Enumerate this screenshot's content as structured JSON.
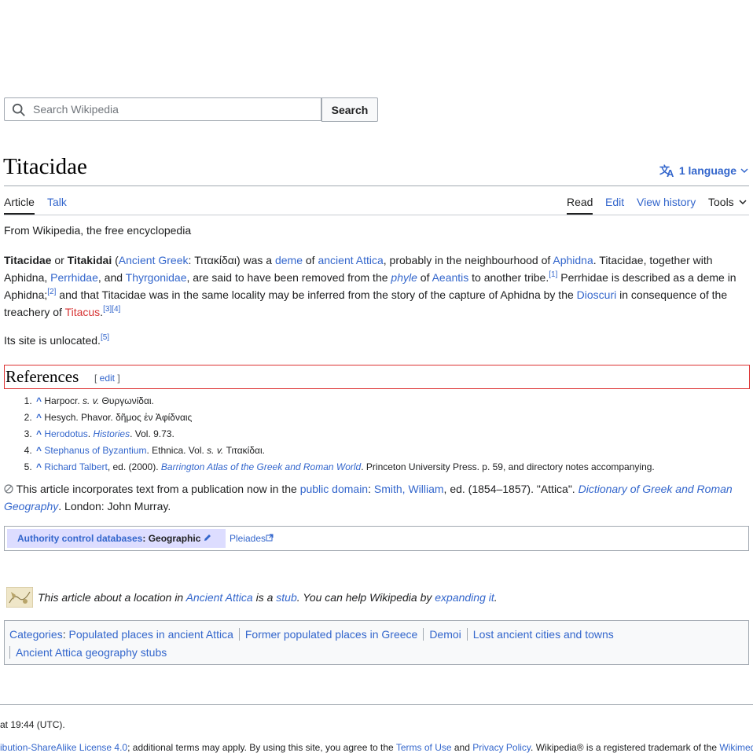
{
  "search": {
    "placeholder": "Search Wikipedia",
    "button_label": "Search"
  },
  "title": "Titacidae",
  "language": {
    "label": "1 language"
  },
  "tabs": {
    "article": "Article",
    "talk": "Talk",
    "read": "Read",
    "edit": "Edit",
    "history": "View history",
    "tools": "Tools"
  },
  "tagline": "From Wikipedia, the free encyclopedia",
  "lead": {
    "s1": "Titacidae",
    "s2": " or ",
    "s3": "Titakidai",
    "s4": " (",
    "l_ancient_greek": "Ancient Greek",
    "s5": ": Τιτακίδαι) was a ",
    "l_deme": "deme",
    "s6": " of ",
    "l_ancient_attica": "ancient Attica",
    "s7": ", probably in the neighbourhood of ",
    "l_aphidna": "Aphidna",
    "s8": ". Titacidae, together with Aphidna, ",
    "l_perrhidae": "Perrhidae",
    "s9": ", and ",
    "l_thyrgonidae": "Thyrgonidae",
    "s10": ", are said to have been removed from the ",
    "l_phyle": "phyle",
    "s11": " of ",
    "l_aeantis": "Aeantis",
    "s12": " to another tribe.",
    "ref1": "[1]",
    "s13": " Perrhidae is described as a deme in Aphidna;",
    "ref2": "[2]",
    "s14": " and that Titacidae was in the same locality may be inferred from the story of the capture of Aphidna by the ",
    "l_dioscuri": "Dioscuri",
    "s15": " in consequence of the treachery of ",
    "l_titacus": "Titacus",
    "s16": ".",
    "ref34": "[3][4]"
  },
  "site": {
    "text": "Its site is unlocated.",
    "ref": "[5]"
  },
  "references": {
    "heading": "References",
    "edit_open": "[ ",
    "edit": "edit",
    "edit_close": " ]",
    "items": [
      {
        "caret": "^",
        "a": "Harpocr. ",
        "b": "s. v.",
        "c": " Θυργωνίδαι."
      },
      {
        "caret": "^",
        "a": "Hesych. Phavor. δῆμος ἐν Ἀφίδναις"
      },
      {
        "caret": "^",
        "link": "Herodotus",
        "a": ". ",
        "italic_link": "Histories",
        "c": ". Vol. 9.73."
      },
      {
        "caret": "^",
        "link": "Stephanus of Byzantium",
        "a": ". Ethnica. Vol. ",
        "b": "s. v.",
        "c": " Τιτακίδαι."
      },
      {
        "caret": "^",
        "link": "Richard Talbert",
        "a": ", ed. (2000). ",
        "italic_link": "Barrington Atlas of the Greek and Roman World",
        "c": ". Princeton University Press. p. 59, and directory notes accompanying."
      }
    ]
  },
  "public_domain": {
    "t1": " This article incorporates text from a publication now in the ",
    "l1": "public domain",
    "t2": ": ",
    "l2": "Smith, William",
    "t3": ", ed. (1854–1857). \"Attica\". ",
    "l3": "Dictionary of Greek and Roman Geography",
    "t4": ". London: John Murray."
  },
  "authority": {
    "label": "Authority control databases",
    "colon": ": Geographic",
    "pleiades": "Pleiades"
  },
  "stub": {
    "t1": "This article about a location in ",
    "l1": "Ancient Attica",
    "t2": " is a ",
    "l2": "stub",
    "t3": ". You can help Wikipedia by ",
    "l3": "expanding it",
    "t4": "."
  },
  "categories": {
    "label": "Categories",
    "items": [
      "Populated places in ancient Attica",
      "Former populated places in Greece",
      "Demoi",
      "Lost ancient cities and towns",
      "Ancient Attica geography stubs"
    ]
  },
  "footer": {
    "line1": "at 19:44 (UTC).",
    "l_license": "ibution-ShareAlike License 4.0",
    "t1": "; additional terms may apply. By using this site, you agree to the ",
    "l_terms": "Terms of Use",
    "t2": " and ",
    "l_privacy": "Privacy Policy",
    "t3": ". Wikipedia® is a registered trademark of the ",
    "l_wikimedia": "Wikimed"
  }
}
